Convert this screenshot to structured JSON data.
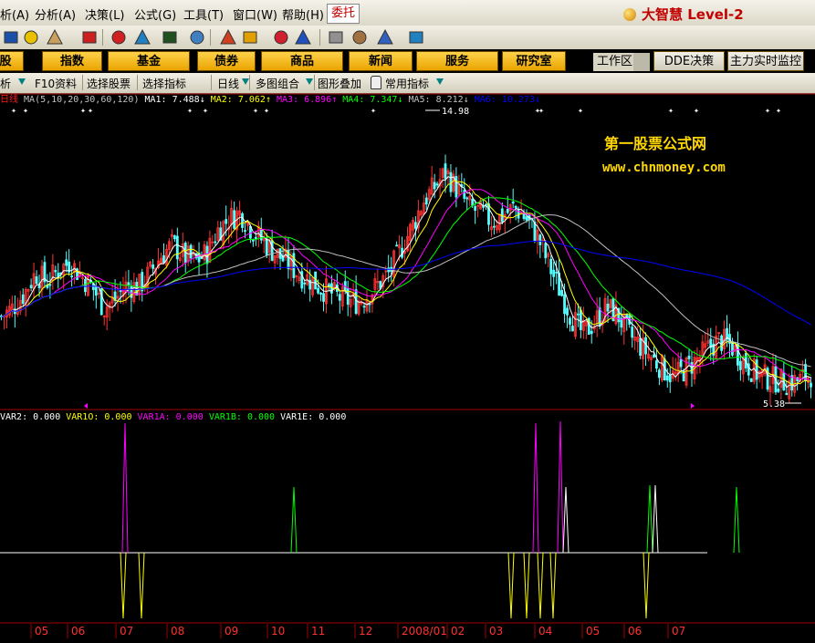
{
  "menubar": {
    "items": [
      "析(A)",
      "分析(A)",
      "决策(L)",
      "公式(G)",
      "工具(T)",
      "窗口(W)",
      "帮助(H)"
    ],
    "weituo": "委托",
    "brand": "大智慧 Level-2"
  },
  "toolbar": {
    "icons": [
      "window-icon",
      "move-icon",
      "ruler-icon",
      "dollar-icon",
      "link-icon",
      "bars-icon",
      "binoculars-icon",
      "wand-icon",
      "question-icon",
      "diamond-icon",
      "candy-icon",
      "candy2-icon",
      "camera-icon",
      "note-icon",
      "panel-icon",
      "books-icon",
      "help-cursor-icon"
    ]
  },
  "navbar": {
    "buttons": [
      "股",
      "指数",
      "基金",
      "债券",
      "商品",
      "新闻",
      "服务",
      "研究室"
    ],
    "workzone": "工作区",
    "dde": "DDE决策",
    "monitor": "主力实时监控"
  },
  "tabbar": {
    "items": [
      "析",
      "F10资料",
      "选择股票",
      "选择指标",
      "日线",
      "多图组合",
      "图形叠加",
      "常用指标"
    ]
  },
  "legend": {
    "period": "日线",
    "ma_label": "MA(5,10,20,30,60,120)",
    "ma": [
      {
        "name": "MA1",
        "value": "7.488",
        "arrow": "↓",
        "color": "#ffffff"
      },
      {
        "name": "MA2",
        "value": "7.062",
        "arrow": "↑",
        "color": "#ffff00"
      },
      {
        "name": "MA3",
        "value": "6.896",
        "arrow": "↑",
        "color": "#ff00ff"
      },
      {
        "name": "MA4",
        "value": "7.347",
        "arrow": "↓",
        "color": "#00ff00"
      },
      {
        "name": "MA5",
        "value": "8.212",
        "arrow": "↓",
        "color": "#c0c0c0"
      },
      {
        "name": "MA6",
        "value": "10.273",
        "arrow": "↓",
        "color": "#0000ff"
      }
    ]
  },
  "watermark": {
    "title": "第一股票公式网",
    "url": "www.chnmoney.com"
  },
  "annotations": {
    "high": "14.98",
    "low": "5.38"
  },
  "indicator": {
    "items": [
      {
        "name": "VAR2",
        "value": "0.000",
        "color": "#ffffff"
      },
      {
        "name": "VAR1O",
        "value": "0.000",
        "color": "#ffff00"
      },
      {
        "name": "VAR1A",
        "value": "0.000",
        "color": "#ff00ff"
      },
      {
        "name": "VAR1B",
        "value": "0.000",
        "color": "#00ff00"
      },
      {
        "name": "VAR1E",
        "value": "0.000",
        "color": "#ffffff"
      }
    ]
  },
  "xaxis": {
    "labels": [
      "05",
      "06",
      "07",
      "08",
      "09",
      "10",
      "11",
      "12",
      "2008/01",
      "02",
      "03",
      "04",
      "05",
      "06",
      "07"
    ]
  },
  "chart_data": {
    "type": "candlestick",
    "high": 14.98,
    "low": 5.38,
    "x_ticks": [
      "05",
      "06",
      "07",
      "08",
      "09",
      "10",
      "11",
      "12",
      "2008/01",
      "02",
      "03",
      "04",
      "05",
      "06",
      "07"
    ],
    "close_trend": [
      8.0,
      8.3,
      8.8,
      9.5,
      9.2,
      9.6,
      9.9,
      9.4,
      9.0,
      8.3,
      8.6,
      9.1,
      9.0,
      9.5,
      10.1,
      10.5,
      10.1,
      9.9,
      10.2,
      11.0,
      11.4,
      11.6,
      11.0,
      10.6,
      10.2,
      9.9,
      9.5,
      9.3,
      9.0,
      8.8,
      8.6,
      8.5,
      8.7,
      9.1,
      9.5,
      10.3,
      11.1,
      12.0,
      12.5,
      13.0,
      12.4,
      11.8,
      11.6,
      11.3,
      11.5,
      11.8,
      11.4,
      10.8,
      9.8,
      8.9,
      8.0,
      7.4,
      7.8,
      8.3,
      8.1,
      7.4,
      7.0,
      6.6,
      6.2,
      5.9,
      6.2,
      6.5,
      6.9,
      7.2,
      7.0,
      6.5,
      6.1,
      5.9,
      5.8,
      5.7,
      5.8,
      6.0
    ]
  }
}
